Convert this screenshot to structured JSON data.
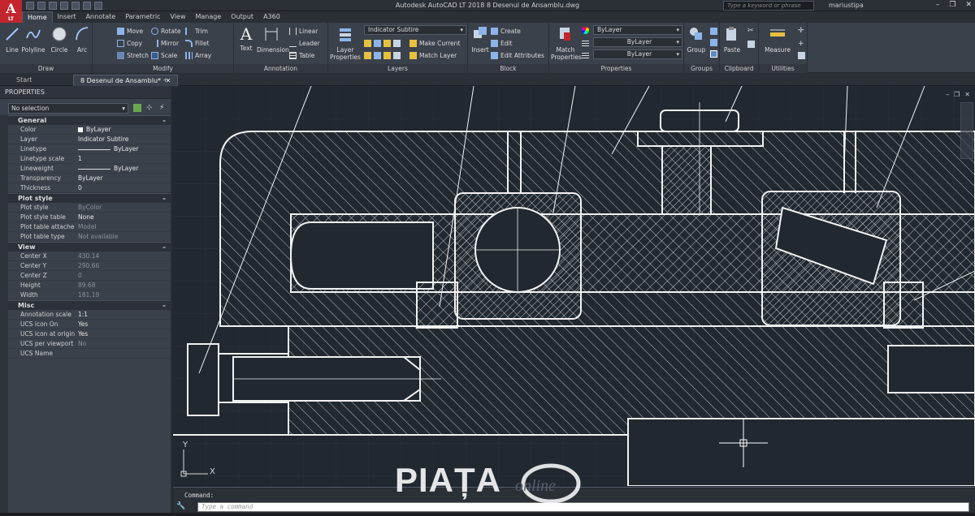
{
  "app": {
    "logo_letter": "A",
    "logo_sub": "LT",
    "title": "Autodesk AutoCAD LT 2018    8 Desenul de Ansamblu.dwg",
    "search_placeholder": "Type a keyword or phrase",
    "user": "mariustipa"
  },
  "ribbon_tabs": [
    "Home",
    "Insert",
    "Annotate",
    "Parametric",
    "View",
    "Manage",
    "Output",
    "A360"
  ],
  "draw": {
    "title": "Draw",
    "line": "Line",
    "polyline": "Polyline",
    "circle": "Circle",
    "arc": "Arc"
  },
  "modify": {
    "title": "Modify",
    "move": "Move",
    "rotate": "Rotate",
    "trim": "Trim",
    "copy": "Copy",
    "mirror": "Mirror",
    "fillet": "Fillet",
    "stretch": "Stretch",
    "scale": "Scale",
    "array": "Array"
  },
  "annotation": {
    "title": "Annotation",
    "text": "Text",
    "dimension": "Dimension",
    "linear": "Linear",
    "leader": "Leader",
    "table": "Table"
  },
  "layers": {
    "title": "Layers",
    "layer_properties": "Layer Properties",
    "current_layer": "Indicator Subtire",
    "make_current": "Make Current",
    "match_layer": "Match Layer"
  },
  "block": {
    "title": "Block",
    "insert": "Insert",
    "create": "Create",
    "edit": "Edit",
    "edit_attributes": "Edit Attributes"
  },
  "properties_panel": {
    "title": "Properties",
    "match_properties": "Match Properties",
    "color": "ByLayer",
    "linetype": "ByLayer",
    "lineweight": "ByLayer"
  },
  "groups": {
    "title": "Groups",
    "group": "Group"
  },
  "clipboard": {
    "title": "Clipboard",
    "paste": "Paste"
  },
  "utilities": {
    "title": "Utilities",
    "measure": "Measure"
  },
  "file_tabs": [
    "Start",
    "8 Desenul de Ansamblu*"
  ],
  "palette": {
    "title": "PROPERTIES",
    "selection": "No selection",
    "sections": [
      {
        "name": "General",
        "rows": [
          {
            "key": "Color",
            "value": "ByLayer",
            "swatch": true
          },
          {
            "key": "Layer",
            "value": "Indicator Subtire"
          },
          {
            "key": "Linetype",
            "value": "ByLayer",
            "line": true
          },
          {
            "key": "Linetype scale",
            "value": "1"
          },
          {
            "key": "Lineweight",
            "value": "ByLayer",
            "line": true
          },
          {
            "key": "Transparency",
            "value": "ByLayer"
          },
          {
            "key": "Thickness",
            "value": "0"
          }
        ]
      },
      {
        "name": "Plot style",
        "rows": [
          {
            "key": "Plot style",
            "value": "ByColor",
            "dim": true
          },
          {
            "key": "Plot style table",
            "value": "None"
          },
          {
            "key": "Plot table attached to",
            "value": "Model",
            "dim": true
          },
          {
            "key": "Plot table type",
            "value": "Not available",
            "dim": true
          }
        ]
      },
      {
        "name": "View",
        "rows": [
          {
            "key": "Center X",
            "value": "430.14",
            "dim": true
          },
          {
            "key": "Center Y",
            "value": "290.66",
            "dim": true
          },
          {
            "key": "Center Z",
            "value": "0",
            "dim": true
          },
          {
            "key": "Height",
            "value": "89.68",
            "dim": true
          },
          {
            "key": "Width",
            "value": "181.19",
            "dim": true
          }
        ]
      },
      {
        "name": "Misc",
        "rows": [
          {
            "key": "Annotation scale",
            "value": "1:1"
          },
          {
            "key": "UCS icon On",
            "value": "Yes"
          },
          {
            "key": "UCS icon at origin",
            "value": "Yes"
          },
          {
            "key": "UCS per viewport",
            "value": "No",
            "dim": true
          },
          {
            "key": "UCS Name",
            "value": ""
          }
        ]
      }
    ]
  },
  "ucs": {
    "x": "X",
    "y": "Y"
  },
  "command": {
    "history": "Command:",
    "placeholder": "Type a command"
  },
  "watermark": {
    "main": "PIAȚA",
    "sub": "online"
  },
  "colors": {
    "canvas": "#212830",
    "ribbon": "#3b414b",
    "logo": "#c2262c",
    "line": "#f2f2f2"
  }
}
